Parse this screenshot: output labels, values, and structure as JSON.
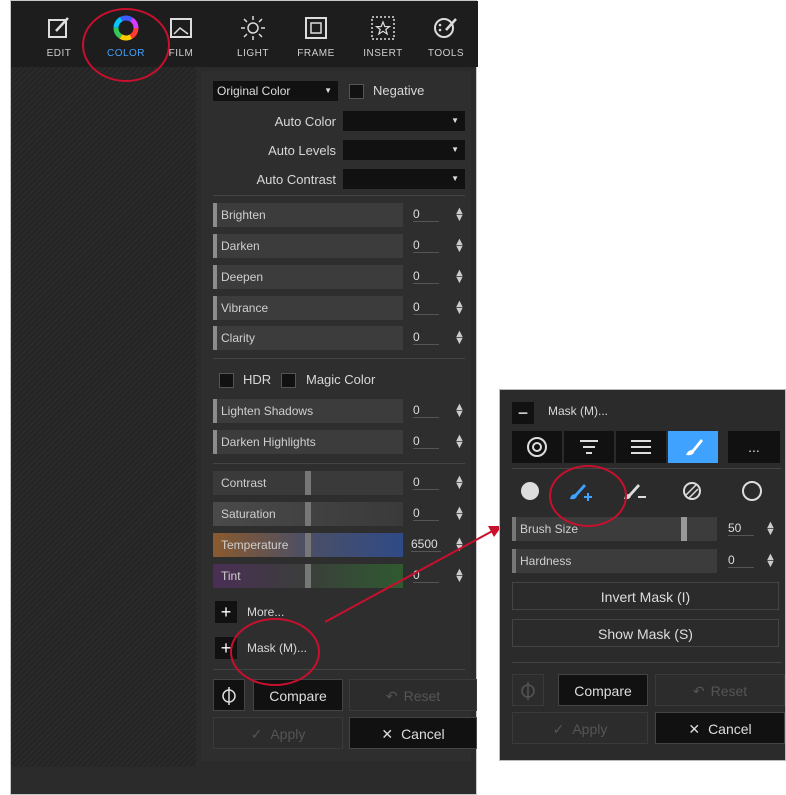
{
  "tabs": [
    {
      "label": "EDIT",
      "icon": "edit-icon"
    },
    {
      "label": "COLOR",
      "icon": "color-wheel-icon"
    },
    {
      "label": "FILM",
      "icon": "film-icon"
    },
    {
      "label": "LIGHT",
      "icon": "light-icon"
    },
    {
      "label": "FRAME",
      "icon": "frame-icon"
    },
    {
      "label": "INSERT",
      "icon": "insert-icon"
    },
    {
      "label": "TOOLS",
      "icon": "tools-icon"
    }
  ],
  "color_panel": {
    "preset_select": "Original Color",
    "negative_label": "Negative",
    "auto_color_label": "Auto Color",
    "auto_levels_label": "Auto Levels",
    "auto_contrast_label": "Auto Contrast",
    "sliders": [
      {
        "label": "Brighten",
        "value": "0"
      },
      {
        "label": "Darken",
        "value": "0"
      },
      {
        "label": "Deepen",
        "value": "0"
      },
      {
        "label": "Vibrance",
        "value": "0"
      },
      {
        "label": "Clarity",
        "value": "0"
      }
    ],
    "hdr_label": "HDR",
    "magic_color_label": "Magic Color",
    "shadow_sliders": [
      {
        "label": "Lighten Shadows",
        "value": "0"
      },
      {
        "label": "Darken Highlights",
        "value": "0"
      }
    ],
    "tone_sliders": [
      {
        "label": "Contrast",
        "value": "0"
      },
      {
        "label": "Saturation",
        "value": "0"
      },
      {
        "label": "Temperature",
        "value": "6500"
      },
      {
        "label": "Tint",
        "value": "0"
      }
    ],
    "more_label": "More...",
    "mask_label": "Mask (M)...",
    "compare_label": "Compare",
    "reset_label": "Reset",
    "apply_label": "Apply",
    "cancel_label": "Cancel"
  },
  "mask_panel": {
    "title": "Mask (M)...",
    "more_label": "...",
    "brush_size_label": "Brush Size",
    "brush_size_value": "50",
    "hardness_label": "Hardness",
    "hardness_value": "0",
    "invert_mask_label": "Invert Mask (I)",
    "show_mask_label": "Show Mask (S)",
    "compare_label": "Compare",
    "reset_label": "Reset",
    "apply_label": "Apply",
    "cancel_label": "Cancel"
  },
  "colors": {
    "accent": "#3fa2ff",
    "annotation_red": "#c8102e",
    "temperature_slider": "#8a5a2e",
    "tint_slider": "#6a3f7a"
  }
}
